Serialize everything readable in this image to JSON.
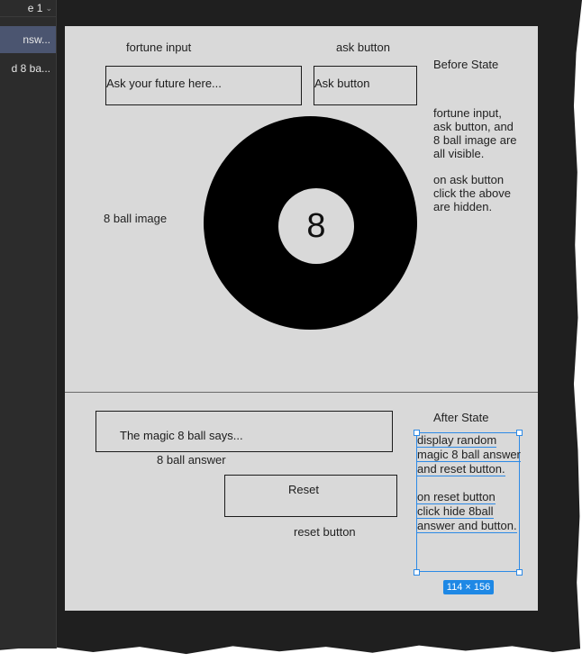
{
  "sidebar": {
    "page_label": "e 1",
    "layers": [
      {
        "label": "nsw..."
      },
      {
        "label": "d 8 ba..."
      }
    ]
  },
  "labels": {
    "fortune_input": "fortune input",
    "ask_button": "ask button",
    "eight_ball_image": "8 ball image",
    "eight_ball_answer": "8 ball answer",
    "reset_button": "reset button"
  },
  "fields": {
    "fortune_placeholder": "Ask your future here...",
    "ask_button_text": "Ask button",
    "magic_answer_text": "The magic 8 ball says...",
    "reset_button_text": "Reset"
  },
  "ball": {
    "number": "8"
  },
  "before_state": {
    "title": "Before State",
    "lines": [
      "fortune input,",
      "ask button, and",
      "8 ball image are",
      "all visible."
    ],
    "lines2": [
      "on ask button",
      "click the above",
      "are hidden."
    ]
  },
  "after_state": {
    "title": "After State",
    "lines": [
      "display random",
      "magic 8 ball answer",
      "and reset button."
    ],
    "lines2": [
      "on  reset button",
      "click hide 8ball",
      "answer and button."
    ]
  },
  "selection": {
    "dimensions": "114 × 156"
  },
  "colors": {
    "canvas_bg": "#1f1f1f",
    "frame_bg": "#d9d9d9",
    "selection_blue": "#2d8ae6",
    "selected_layer": "#4b5570"
  }
}
